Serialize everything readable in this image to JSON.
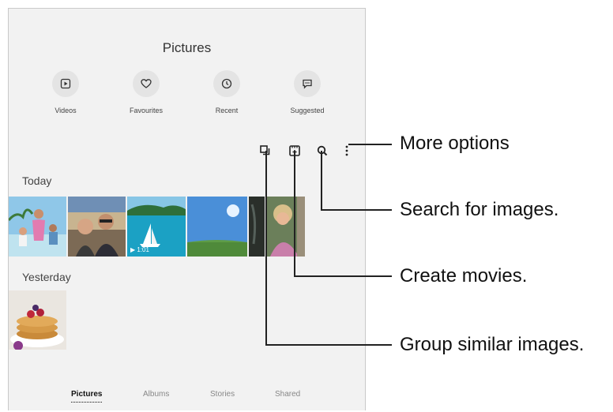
{
  "header": {
    "title": "Pictures"
  },
  "quick_access": [
    {
      "label": "Videos",
      "icon": "video-icon"
    },
    {
      "label": "Favourites",
      "icon": "heart-icon"
    },
    {
      "label": "Recent",
      "icon": "clock-icon"
    },
    {
      "label": "Suggested",
      "icon": "suggest-chat-icon"
    }
  ],
  "toolbar": {
    "icons": [
      "group-similar-icon",
      "create-movie-icon",
      "search-icon",
      "more-options-icon"
    ]
  },
  "sections": {
    "today": "Today",
    "yesterday": "Yesterday"
  },
  "video_badge": {
    "duration": "1:01"
  },
  "bottom_nav": [
    {
      "label": "Pictures",
      "active": true
    },
    {
      "label": "Albums",
      "active": false
    },
    {
      "label": "Stories",
      "active": false
    },
    {
      "label": "Shared",
      "active": false
    }
  ],
  "callouts": {
    "more_options": "More options",
    "search": "Search for images.",
    "create_movies": "Create movies.",
    "group_similar": "Group similar images."
  },
  "colors": {
    "screen_bg": "#f2f2f2",
    "icon_circle": "#e4e4e4",
    "callout_line": "#222222"
  }
}
